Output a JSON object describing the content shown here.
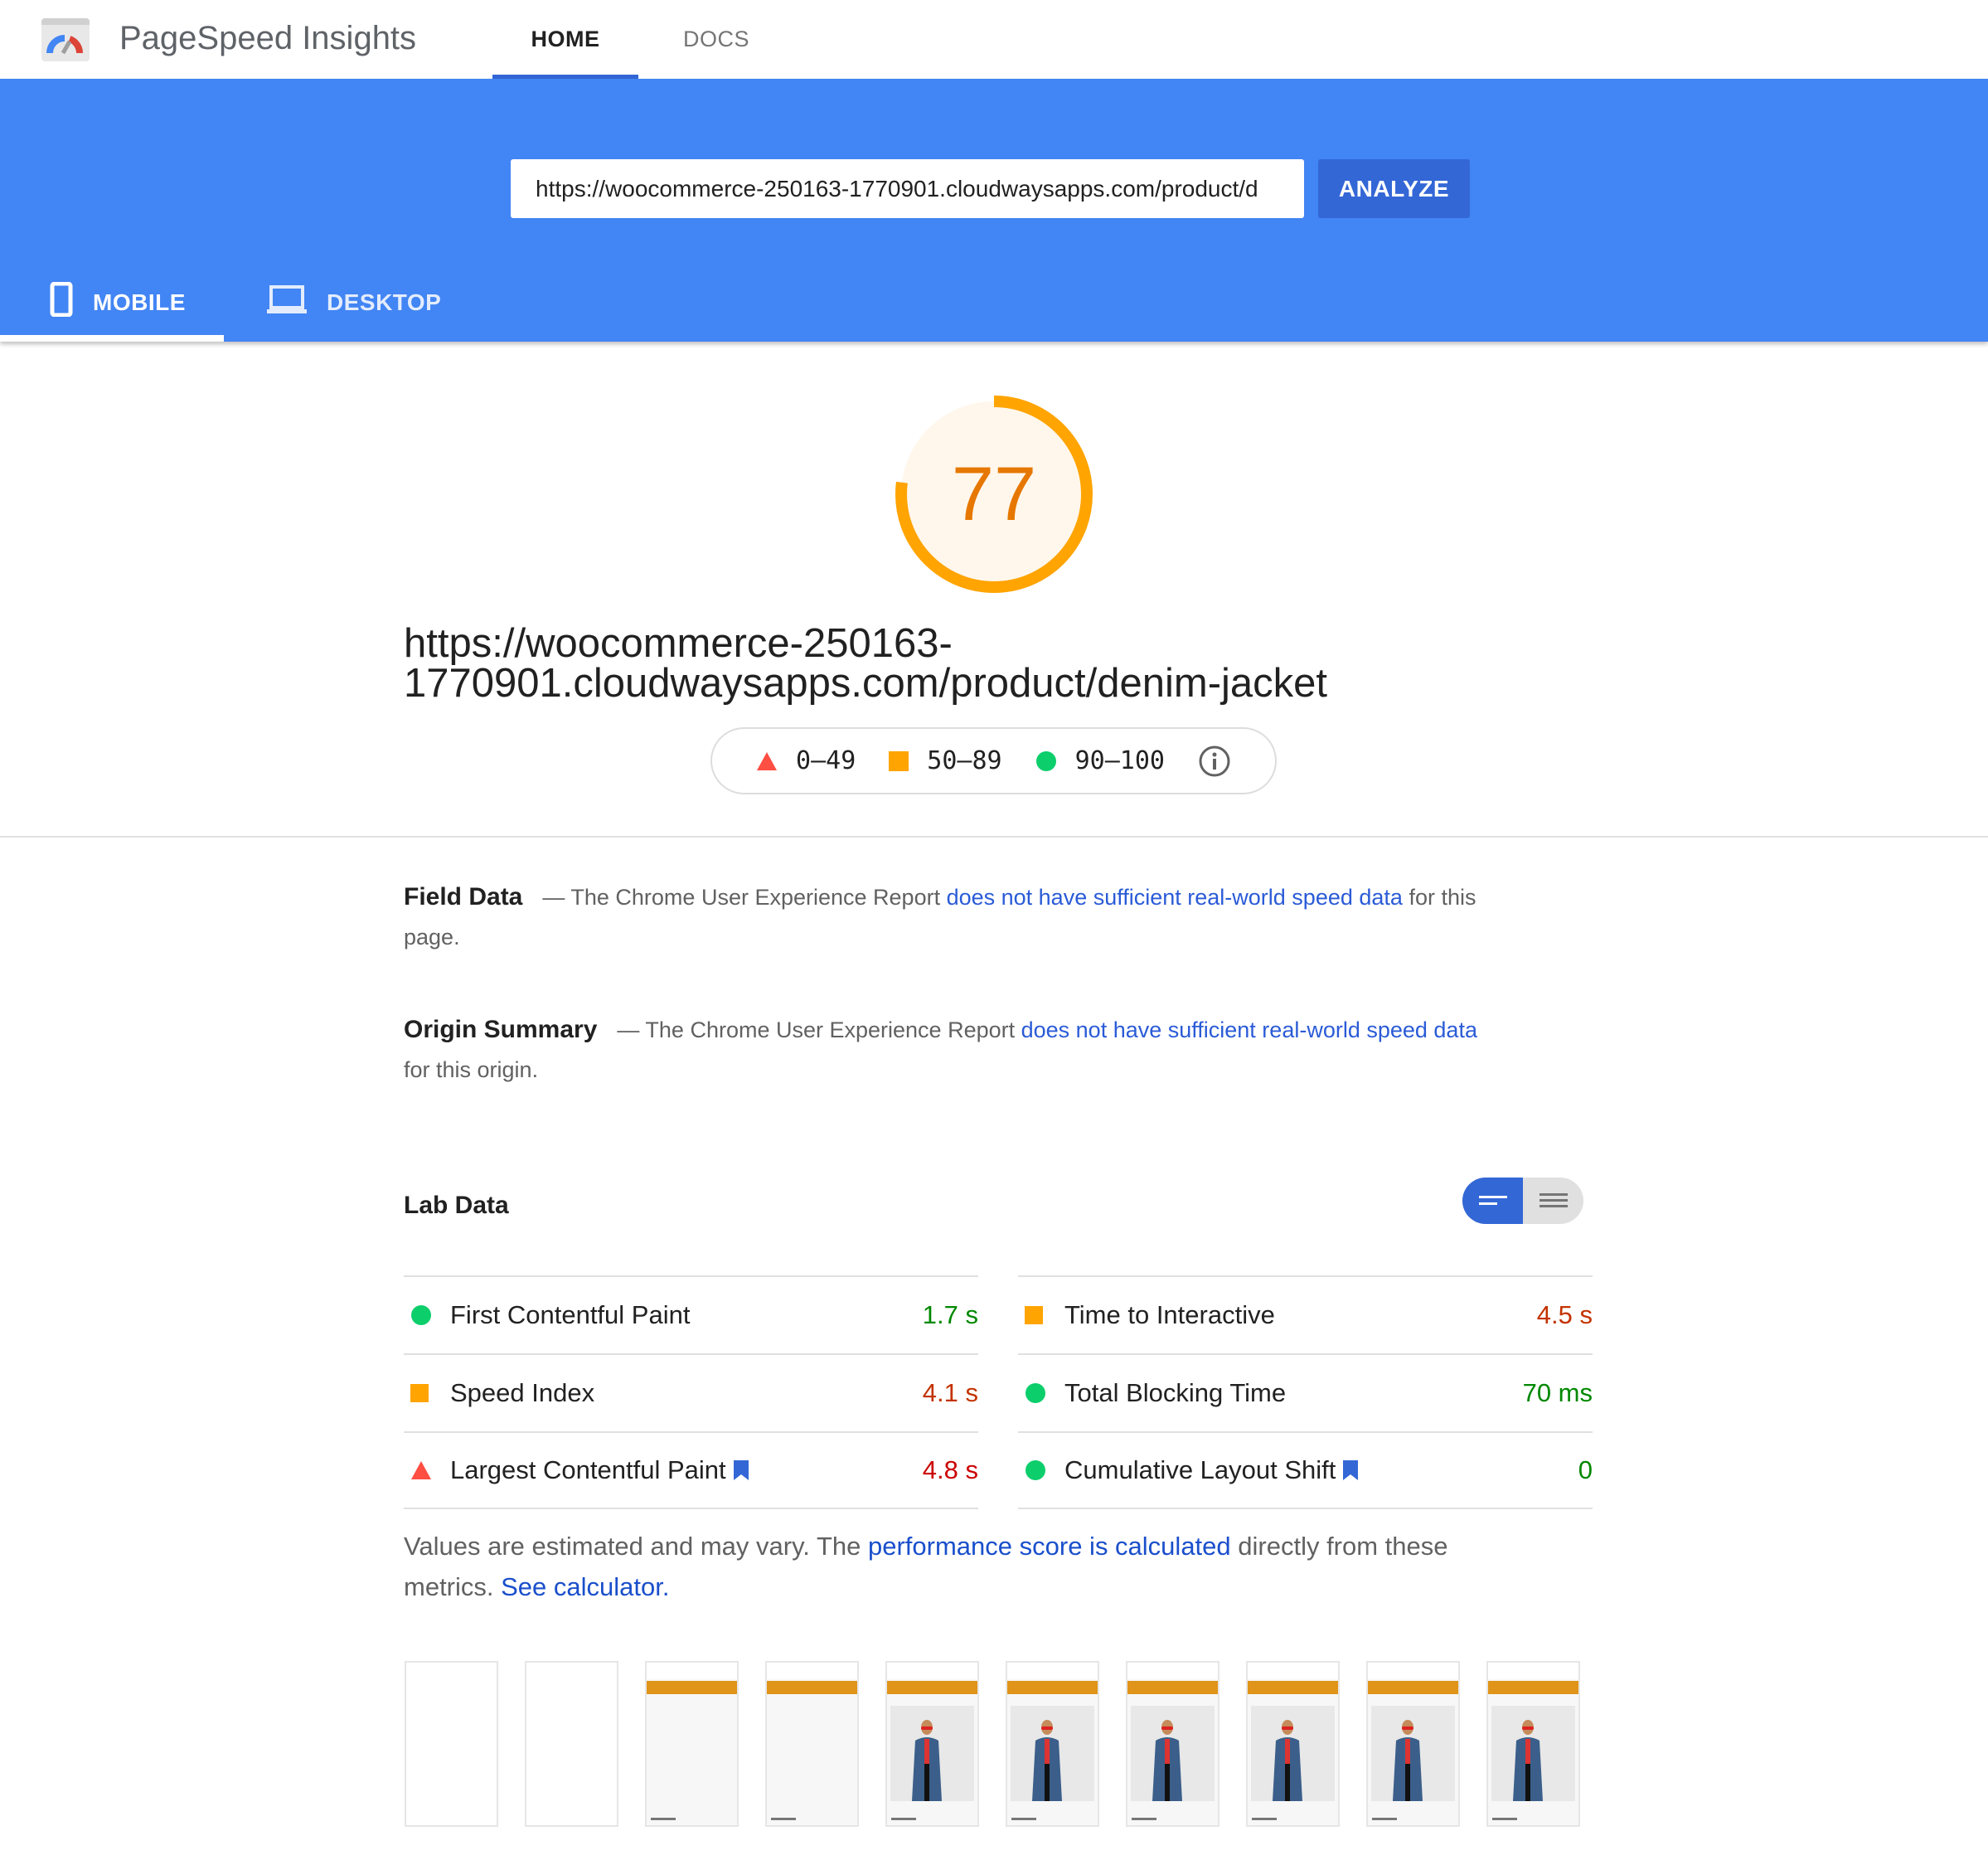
{
  "app": {
    "title": "PageSpeed Insights",
    "nav": [
      {
        "label": "HOME",
        "active": true
      },
      {
        "label": "DOCS",
        "active": false
      }
    ]
  },
  "search": {
    "url_value": "https://woocommerce-250163-1770901.cloudwaysapps.com/product/d",
    "analyze_label": "ANALYZE"
  },
  "device_tabs": [
    {
      "label": "MOBILE",
      "icon": "phone-icon",
      "active": true
    },
    {
      "label": "DESKTOP",
      "icon": "laptop-icon",
      "active": false
    }
  ],
  "score": {
    "value": "77",
    "fraction": 0.77,
    "color": "#ffa400"
  },
  "page_url": "https://woocommerce-250163-1770901.cloudwaysapps.com/product/denim-jacket",
  "legend": [
    {
      "range": "0–49",
      "icon": "triangle-icon",
      "color": "#ff4e42"
    },
    {
      "range": "50–89",
      "icon": "square-icon",
      "color": "#ffa400"
    },
    {
      "range": "90–100",
      "icon": "circle-icon",
      "color": "#0cce6b"
    }
  ],
  "field_data": {
    "title": "Field Data",
    "pre": "— The Chrome User Experience Report ",
    "link": "does not have sufficient real-world speed data",
    "post": " for this page."
  },
  "origin_summary": {
    "title": "Origin Summary",
    "pre": "— The Chrome User Experience Report ",
    "link": "does not have sufficient real-world speed data",
    "post": " for this origin."
  },
  "lab_data": {
    "title": "Lab Data",
    "metrics_left": [
      {
        "name": "First Contentful Paint",
        "value": "1.7 s",
        "status": "pass",
        "bookmark": false
      },
      {
        "name": "Speed Index",
        "value": "4.1 s",
        "status": "average",
        "bookmark": false
      },
      {
        "name": "Largest Contentful Paint",
        "value": "4.8 s",
        "status": "fail",
        "bookmark": true
      }
    ],
    "metrics_right": [
      {
        "name": "Time to Interactive",
        "value": "4.5 s",
        "status": "average",
        "bookmark": false
      },
      {
        "name": "Total Blocking Time",
        "value": "70 ms",
        "status": "pass",
        "bookmark": false
      },
      {
        "name": "Cumulative Layout Shift",
        "value": "0",
        "status": "pass",
        "bookmark": true
      }
    ]
  },
  "footnote": {
    "pre": "Values are estimated and may vary. The ",
    "link1": "performance score is calculated",
    "mid": " directly from these metrics. ",
    "link2": "See calculator."
  },
  "status_colors": {
    "pass": "#0cce6b",
    "average": "#ffa400",
    "fail": "#ff4e42",
    "pass_text": "#008800",
    "average_text": "#c33300",
    "fail_text": "#cc0000",
    "link": "#2a5bd7"
  },
  "filmstrip": [
    "blank",
    "blank",
    "header",
    "header-faint",
    "full",
    "full",
    "full",
    "full",
    "full",
    "full"
  ]
}
